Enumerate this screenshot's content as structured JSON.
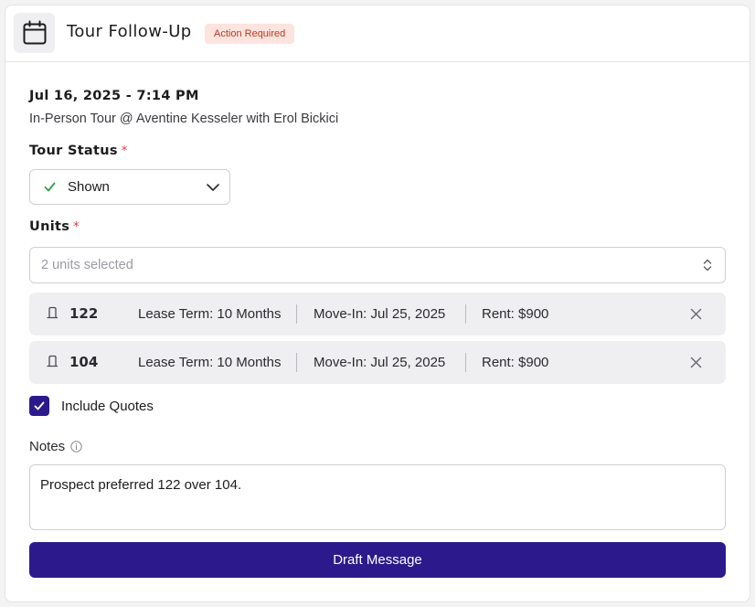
{
  "header": {
    "title": "Tour Follow-Up",
    "badge": "Action Required",
    "icon": "calendar-icon"
  },
  "tour": {
    "datetime": "Jul 16, 2025 - 7:14 PM",
    "description": "In-Person Tour @ Aventine Kesseler with Erol Bickici"
  },
  "tour_status": {
    "label": "Tour Status",
    "required_mark": "*",
    "value": "Shown"
  },
  "units": {
    "label": "Units",
    "required_mark": "*",
    "placeholder": "2 units selected",
    "items": [
      {
        "number": "122",
        "lease": "Lease Term: 10 Months",
        "move_in": "Move-In: Jul 25, 2025",
        "rent": "Rent: $900"
      },
      {
        "number": "104",
        "lease": "Lease Term: 10 Months",
        "move_in": "Move-In: Jul 25, 2025",
        "rent": "Rent: $900"
      }
    ]
  },
  "include_quotes": {
    "label": "Include Quotes",
    "checked": true
  },
  "notes": {
    "label": "Notes",
    "value": "Prospect preferred 122 over 104."
  },
  "actions": {
    "draft_label": "Draft Message"
  },
  "colors": {
    "primary": "#2c1a8c",
    "badge_bg": "#fde4de",
    "badge_text": "#b63a25",
    "required": "#e23b3b",
    "check_green": "#2e9e4a"
  }
}
